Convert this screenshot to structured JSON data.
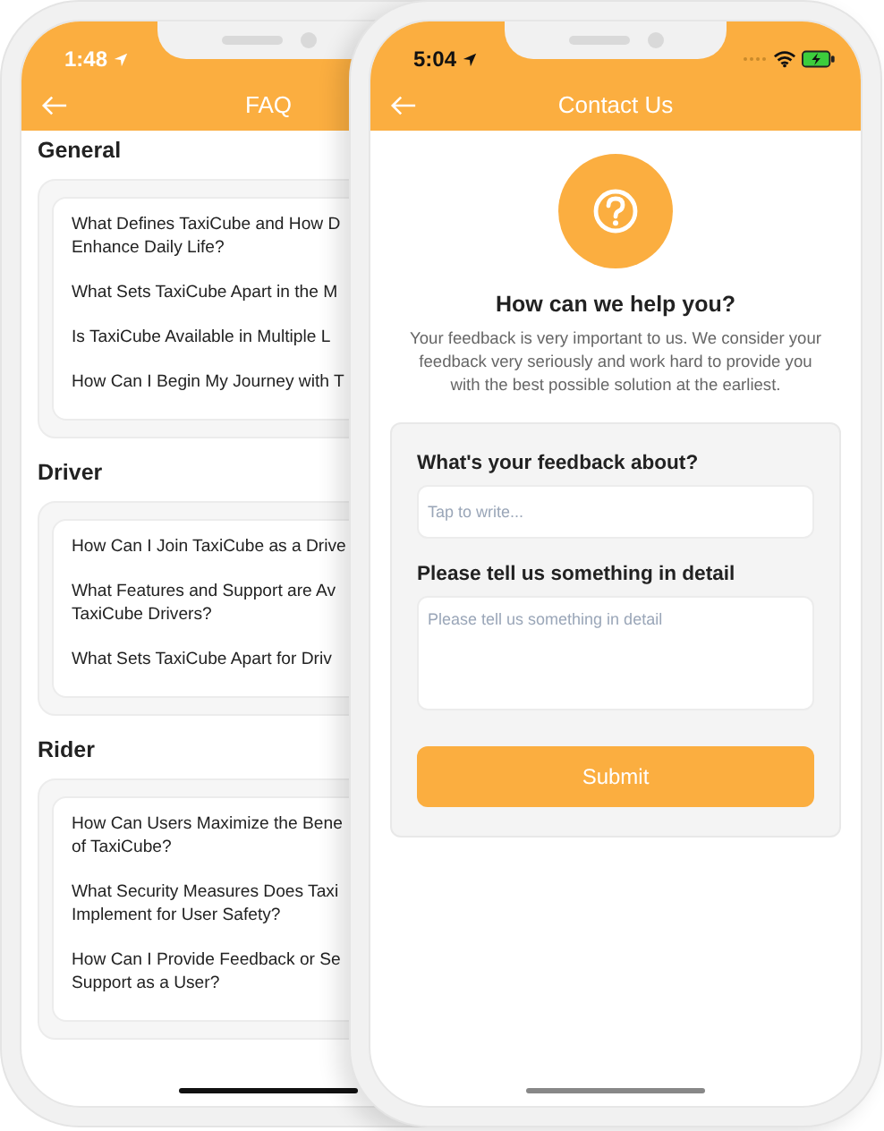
{
  "faq_screen": {
    "status_bar": {
      "time": "1:48"
    },
    "header": {
      "title": "FAQ"
    },
    "sections": [
      {
        "heading": "General",
        "questions": [
          {
            "lines": [
              "What Defines TaxiCube and How D",
              "Enhance Daily Life?"
            ]
          },
          {
            "lines": [
              "What Sets TaxiCube Apart in the M"
            ]
          },
          {
            "lines": [
              "Is TaxiCube Available in Multiple L"
            ]
          },
          {
            "lines": [
              "How Can I Begin My Journey with T"
            ]
          }
        ]
      },
      {
        "heading": "Driver",
        "questions": [
          {
            "lines": [
              "How Can I Join TaxiCube as a Drive"
            ]
          },
          {
            "lines": [
              "What Features and Support are Av",
              "TaxiCube Drivers?"
            ]
          },
          {
            "lines": [
              "What Sets TaxiCube Apart for Driv"
            ]
          }
        ]
      },
      {
        "heading": "Rider",
        "questions": [
          {
            "lines": [
              "How Can Users Maximize the Bene",
              "of TaxiCube?"
            ]
          },
          {
            "lines": [
              "What Security Measures Does Taxi",
              "Implement for User Safety?"
            ]
          },
          {
            "lines": [
              "How Can I Provide Feedback or Se",
              "Support as a User?"
            ]
          }
        ]
      }
    ]
  },
  "contact_screen": {
    "status_bar": {
      "time": "5:04"
    },
    "header": {
      "title": "Contact Us"
    },
    "heading": "How can we help you?",
    "description": "Your feedback is very important to us. We consider your feedback very seriously and work hard to provide you with the best possible solution at the earliest.",
    "form": {
      "fields": [
        {
          "kind": "input",
          "label": "What's your feedback about?",
          "placeholder": "Tap to write..."
        },
        {
          "kind": "textarea",
          "label": "Please tell us something in detail",
          "placeholder": "Please tell us something in detail"
        }
      ],
      "submit": "Submit"
    }
  }
}
